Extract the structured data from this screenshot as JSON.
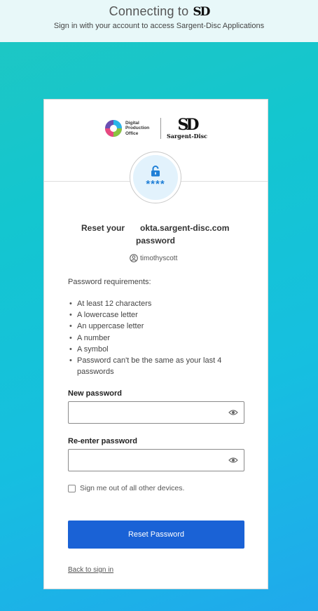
{
  "header": {
    "title": "Connecting to",
    "brand_mark": "SD",
    "subtitle": "Sign in with your account to access Sargent-Disc Applications"
  },
  "logos": {
    "dpo_lines": [
      "Digital",
      "Production",
      "Office"
    ],
    "sd_mark": "SD",
    "sd_name": "Sargent-Disc"
  },
  "badge": {
    "icon": "padlock-icon",
    "stars": "****"
  },
  "heading": {
    "line1_prefix": "Reset your",
    "line1_domain": "okta.sargent-disc.com",
    "line2": "password"
  },
  "user": {
    "icon": "user-circle-icon",
    "name": "timothyscott"
  },
  "requirements": {
    "title": "Password requirements:",
    "items": [
      "At least 12 characters",
      "A lowercase letter",
      "An uppercase letter",
      "A number",
      "A symbol",
      "Password can't be the same as your last 4 passwords"
    ]
  },
  "form": {
    "new_password_label": "New password",
    "new_password_value": "",
    "reenter_password_label": "Re-enter password",
    "reenter_password_value": "",
    "signout_label": "Sign me out of all other devices.",
    "signout_checked": false,
    "submit_label": "Reset Password",
    "back_link": "Back to sign in"
  },
  "colors": {
    "accent": "#1a62d6",
    "badge_bg": "#e2f2fc",
    "lock": "#1f7fd6",
    "top_bar": "#e8f8f9"
  }
}
